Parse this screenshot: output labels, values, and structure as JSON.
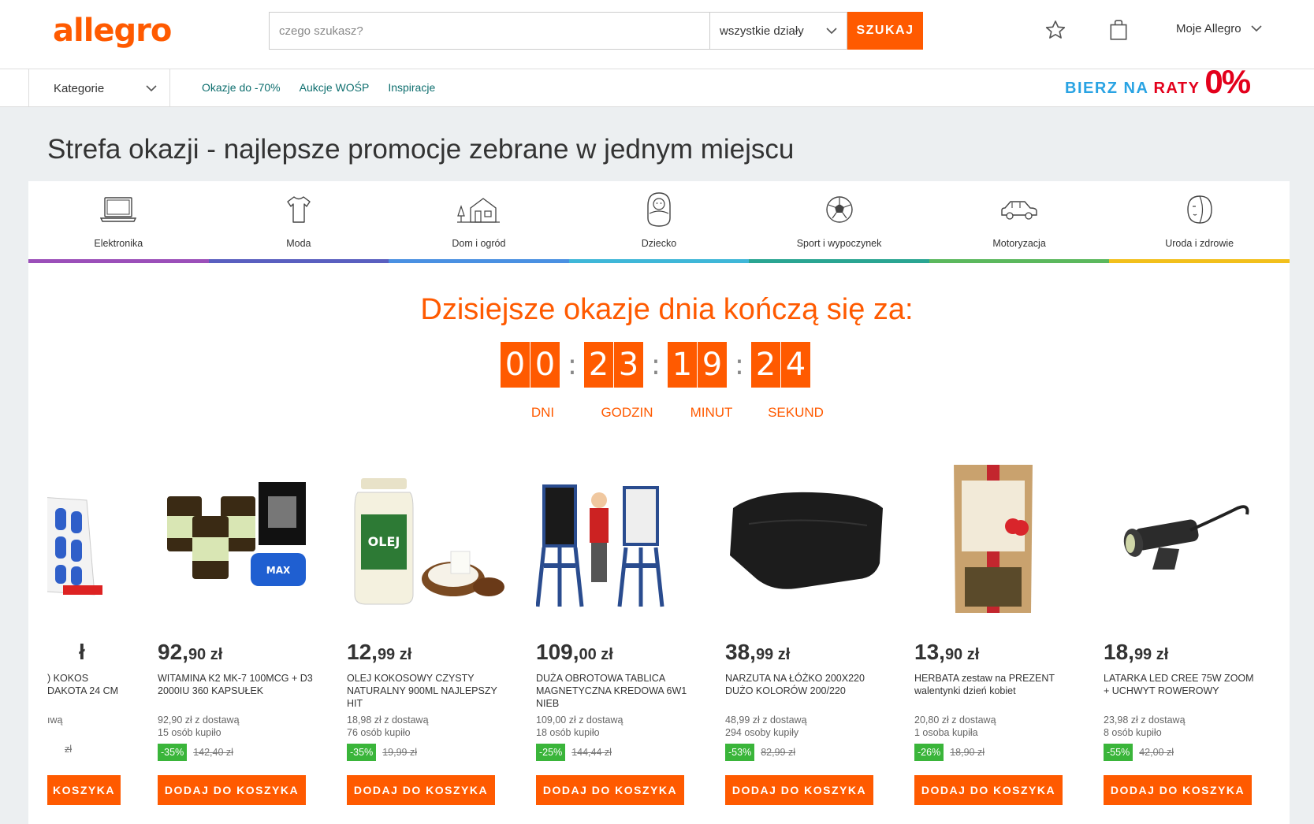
{
  "header": {
    "logo": "allegro",
    "search_placeholder": "czego szukasz?",
    "department": "wszystkie działy",
    "search_button": "SZUKAJ",
    "account_label": "Moje Allegro"
  },
  "nav": {
    "categories_label": "Kategorie",
    "links": [
      "Okazje do -70%",
      "Aukcje WOŚP",
      "Inspiracje"
    ],
    "promo": {
      "part1": "BIERZ NA",
      "part2": "RATY",
      "part3": "0%"
    }
  },
  "page_title": "Strefa okazji - najlepsze promocje zebrane w jednym miejscu",
  "categories": [
    {
      "label": "Elektronika",
      "icon": "laptop-icon",
      "color": "#9b4fb9"
    },
    {
      "label": "Moda",
      "icon": "shirt-icon",
      "color": "#5a5fc0"
    },
    {
      "label": "Dom i ogród",
      "icon": "house-icon",
      "color": "#4a90e2"
    },
    {
      "label": "Dziecko",
      "icon": "baby-icon",
      "color": "#3fb7d8"
    },
    {
      "label": "Sport i wypoczynek",
      "icon": "football-icon",
      "color": "#2aa592"
    },
    {
      "label": "Motoryzacja",
      "icon": "car-icon",
      "color": "#5bb85d"
    },
    {
      "label": "Uroda i zdrowie",
      "icon": "face-icon",
      "color": "#f2c01c"
    }
  ],
  "countdown": {
    "title": "Dzisiejsze okazje dnia kończą się za:",
    "days": [
      "0",
      "0"
    ],
    "hours": [
      "2",
      "3"
    ],
    "minutes": [
      "1",
      "9"
    ],
    "seconds": [
      "2",
      "4"
    ],
    "labels": [
      "DNI",
      "GODZIN",
      "MINUT",
      "SEKUND"
    ]
  },
  "products": [
    {
      "price_main": "ł",
      "price_dec": "",
      "name": ") Kokos DAKOTA 24 cm",
      "shipping": "ıwą",
      "bought": "",
      "discount": "",
      "old_price": "zł",
      "button": "KOSZYKA",
      "image": "mattress",
      "partial": true
    },
    {
      "price_main": "92,",
      "price_dec": "90 zł",
      "name": "Witamina K2 MK-7 100mcg + D3 2000IU 360 KAPSUŁEK",
      "shipping": "92,90 zł z dostawą",
      "bought": "15 osób kupiło",
      "discount": "-35%",
      "old_price": "142,40 zł",
      "button": "DODAJ DO KOSZYKA",
      "image": "vitamins"
    },
    {
      "price_main": "12,",
      "price_dec": "99 zł",
      "name": "OLEJ KOKOSOWY CZYSTY NATURALNY 900ml NAJLEPSZY HIT",
      "shipping": "18,98 zł z dostawą",
      "bought": "76 osób kupiło",
      "discount": "-35%",
      "old_price": "19,99 zł",
      "button": "DODAJ DO KOSZYKA",
      "image": "oil"
    },
    {
      "price_main": "109,",
      "price_dec": "00 zł",
      "name": "DUŻA OBROTOWA TABLICA MAGNETYCZNA KREDOWA 6W1 NIEB",
      "shipping": "109,00 zł z dostawą",
      "bought": "18 osób kupiło",
      "discount": "-25%",
      "old_price": "144,44 zł",
      "button": "DODAJ DO KOSZYKA",
      "image": "easel"
    },
    {
      "price_main": "38,",
      "price_dec": "99 zł",
      "name": "NARZUTA NA ŁÓŻKO 200x220 DUŻO KOLORÓW 200/220",
      "shipping": "48,99 zł z dostawą",
      "bought": "294 osoby kupiły",
      "discount": "-53%",
      "old_price": "82,99 zł",
      "button": "DODAJ DO KOSZYKA",
      "image": "blanket"
    },
    {
      "price_main": "13,",
      "price_dec": "90 zł",
      "name": "HERBATA zestaw na PREZENT walentynki dzień kobiet",
      "shipping": "20,80 zł z dostawą",
      "bought": "1 osoba kupiła",
      "discount": "-26%",
      "old_price": "18,90 zł",
      "button": "DODAJ DO KOSZYKA",
      "image": "tea"
    },
    {
      "price_main": "18,",
      "price_dec": "99 zł",
      "name": "LATARKA LED CREE 75W ZOOM + UCHWYT ROWEROWY",
      "shipping": "23,98 zł z dostawą",
      "bought": "8 osób kupiło",
      "discount": "-55%",
      "old_price": "42,00 zł",
      "button": "DODAJ DO KOSZYKA",
      "image": "flashlight"
    }
  ]
}
